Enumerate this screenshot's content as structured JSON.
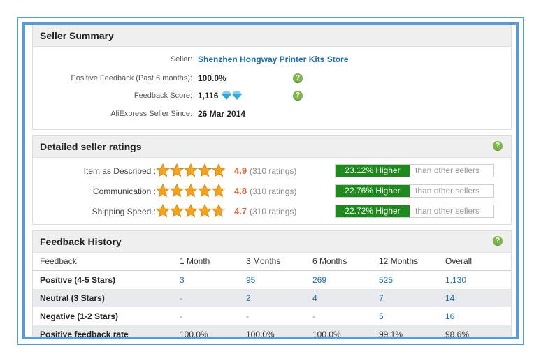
{
  "seller_summary": {
    "title": "Seller Summary",
    "rows": [
      {
        "label": "Seller:",
        "value": "Shenzhen Hongway Printer Kits Store",
        "help": ""
      },
      {
        "label": "Positive Feedback (Past 6 months):",
        "value": "100.0%",
        "help": "?"
      },
      {
        "label": "Feedback Score:",
        "value": "1,116",
        "help": "?"
      },
      {
        "label": "AliExpress Seller Since:",
        "value": "26 Mar 2014",
        "help": ""
      }
    ]
  },
  "detailed_ratings": {
    "title": "Detailed seller ratings",
    "help": "?",
    "rows": [
      {
        "label": "Item as Described :",
        "score": "4.9",
        "count": "(310 ratings)",
        "compare": "23.12% Higher",
        "rest": "than other sellers",
        "stars": 4.9
      },
      {
        "label": "Communication :",
        "score": "4.8",
        "count": "(310 ratings)",
        "compare": "22.76% Higher",
        "rest": "than other sellers",
        "stars": 4.8
      },
      {
        "label": "Shipping Speed :",
        "score": "4.7",
        "count": "(310 ratings)",
        "compare": "22.72% Higher",
        "rest": "than other sellers",
        "stars": 4.7
      }
    ]
  },
  "feedback_history": {
    "title": "Feedback History",
    "help": "?",
    "headers": [
      "Feedback",
      "1 Month",
      "3 Months",
      "6 Months",
      "12 Months",
      "Overall"
    ],
    "rows": [
      {
        "label": "Positive (4-5 Stars)",
        "cells": [
          "3",
          "95",
          "269",
          "525",
          "1,130"
        ]
      },
      {
        "label": "Neutral (3 Stars)",
        "cells": [
          "-",
          "2",
          "4",
          "7",
          "14"
        ]
      },
      {
        "label": "Negative (1-2 Stars)",
        "cells": [
          "-",
          "-",
          "-",
          "5",
          "16"
        ]
      },
      {
        "label": "Positive feedback rate",
        "cells": [
          "100.0%",
          "100.0%",
          "100.0%",
          "99.1%",
          "98.6%"
        ]
      }
    ]
  },
  "colors": {
    "frame": "#5b9bd5",
    "link": "#1a6eb5",
    "score": "#e0663b",
    "compare_bg": "#1e8a1e",
    "star": "#f7a21b",
    "help": "#82b64c",
    "diamond": "#2fa8e0"
  }
}
